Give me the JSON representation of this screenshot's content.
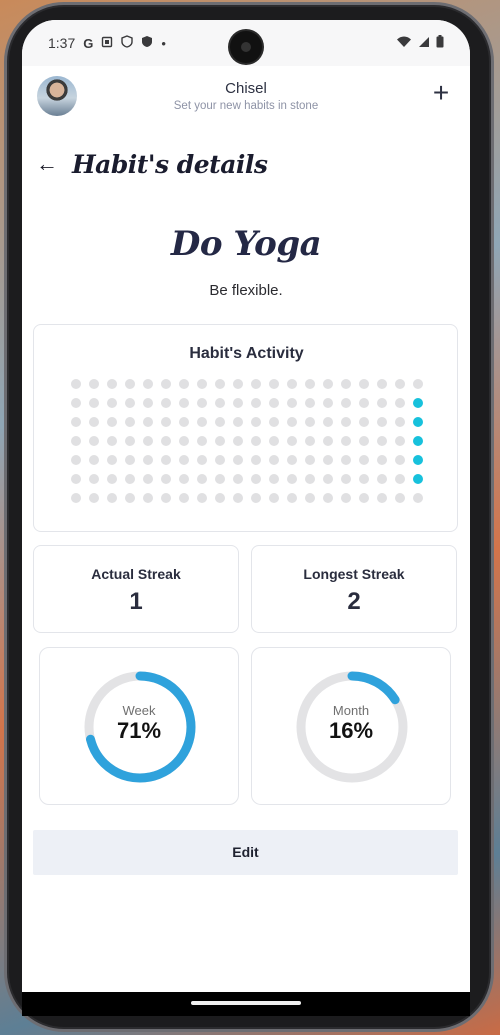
{
  "status_bar": {
    "time": "1:37",
    "icons": [
      "google-g-icon",
      "screenshot-icon",
      "shield-icon",
      "shield-filled-icon",
      "dot-icon"
    ],
    "right_icons": [
      "wifi-icon",
      "signal-icon",
      "battery-icon"
    ]
  },
  "app_bar": {
    "title": "Chisel",
    "subtitle": "Set your new habits in stone",
    "add_label": "+"
  },
  "page": {
    "back_label": "←",
    "title": "Habit's details"
  },
  "habit": {
    "name": "Do Yoga",
    "description": "Be flexible."
  },
  "activity": {
    "title": "Habit's Activity",
    "columns": 20,
    "rows": 7,
    "active_cells": [
      [
        19,
        1
      ],
      [
        19,
        2
      ],
      [
        19,
        3
      ],
      [
        19,
        4
      ],
      [
        19,
        5
      ]
    ],
    "active_color": "#17c1dc",
    "inactive_color": "#e0e0e2"
  },
  "streaks": {
    "actual_label": "Actual Streak",
    "actual_value": "1",
    "longest_label": "Longest Streak",
    "longest_value": "2"
  },
  "progress": {
    "week_label": "Week",
    "week_value": "71%",
    "week_fraction": 0.71,
    "month_label": "Month",
    "month_value": "16%",
    "month_fraction": 0.16,
    "ring_color": "#2fa2dc",
    "track_color": "#e3e3e5"
  },
  "actions": {
    "edit_label": "Edit"
  }
}
